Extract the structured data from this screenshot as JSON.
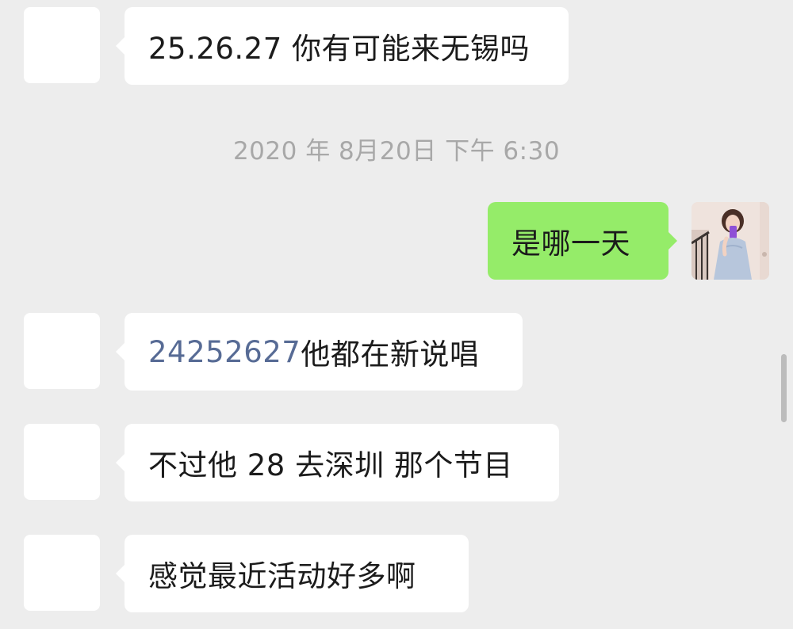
{
  "messages": [
    {
      "sender": "other",
      "text": "25.26.27 你有可能来无锡吗"
    },
    {
      "sender": "self",
      "text": "是哪一天"
    },
    {
      "sender": "other",
      "link_number": "24252627",
      "text": "他都在新说唱"
    },
    {
      "sender": "other",
      "text": "不过他 28 去深圳 那个节目"
    },
    {
      "sender": "other",
      "text": "感觉最近活动好多啊"
    }
  ],
  "timestamp": "2020 年 8月20日 下午 6:30",
  "colors": {
    "background": "#ededed",
    "incoming_bubble": "#ffffff",
    "outgoing_bubble": "#95ec69",
    "link": "#576b95",
    "timestamp": "#a8a8a8"
  },
  "icons": {
    "self_avatar": "avatar-photo",
    "other_avatar": "avatar-blank"
  }
}
